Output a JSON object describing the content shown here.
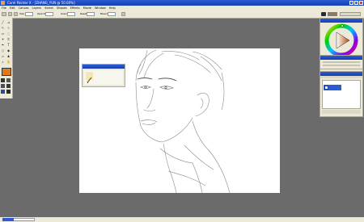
{
  "app": {
    "title": "Corel Painter X - [ZHANG_YUN @ 50.00%]",
    "titlebar_color": "#1f4fc8"
  },
  "menubar": {
    "items": [
      "File",
      "Edit",
      "Canvas",
      "Layers",
      "Select",
      "Shapes",
      "Effects",
      "Movie",
      "Window",
      "Help"
    ]
  },
  "propbar": {
    "size_label": "Size",
    "opacity_label": "Opacity",
    "grain_label": "Grain",
    "resat_label": "Resat",
    "bleed_label": "Bleed"
  },
  "colors_panel": {
    "hue_wheel": "color-wheel",
    "current_color": "#8a4a18"
  },
  "layers_panel": {
    "items": [
      "Layer 1",
      "Canvas"
    ],
    "selected_index": 0
  },
  "statusbar": {
    "progress_fraction": 0.35
  },
  "colors": {
    "workspace": "#6b6b6b",
    "canvas": "#ffffff",
    "chrome": "#ece9d8",
    "accent_orange": "#e07a1f"
  }
}
